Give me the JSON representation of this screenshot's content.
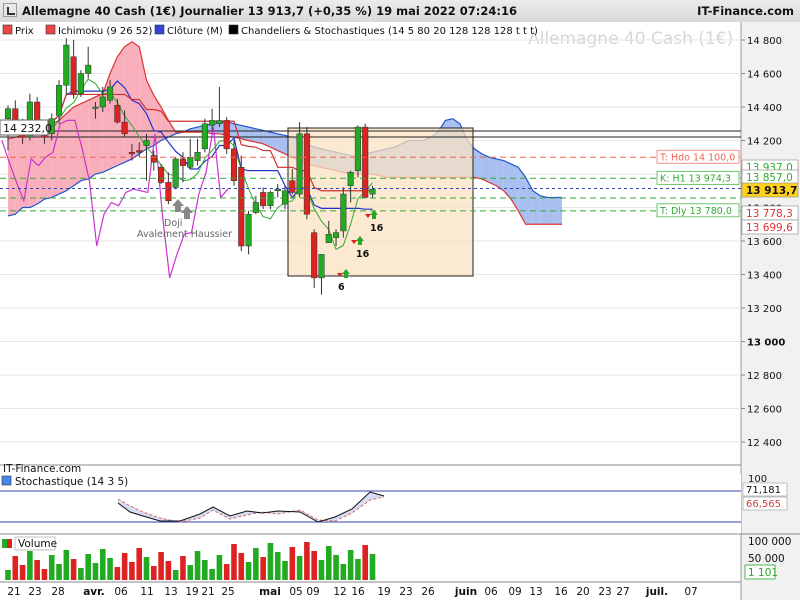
{
  "header": {
    "title": "Allemagne 40 Cash (1€) Journalier 13 913,7 (+0,35 %) 19 mai 2022 07:24:16",
    "brand": "IT-Finance.com",
    "watermark": "Allemagne 40 Cash (1€)"
  },
  "legend": [
    {
      "label": "Prix",
      "color": "#ee4444"
    },
    {
      "label": "Ichimoku (9 26 52)",
      "color": "#ee4444"
    },
    {
      "label": "Clôture (M)",
      "color": "#3344dd"
    },
    {
      "label": "Chandeliers & Stochastiques (14 5 80 20 128 128 128 t t t)",
      "color": "#000000"
    }
  ],
  "price_axis": {
    "ticks": [
      "14 800",
      "14 600",
      "14 400",
      "14 200",
      "14 000",
      "13 800",
      "13 600",
      "13 400",
      "13 200",
      "13 000",
      "12 800",
      "12 600",
      "12 400"
    ],
    "last_price": "13 913,7",
    "level_labels": [
      "13 778,3",
      "13 699,6",
      "13 937,0",
      "13 857,0"
    ]
  },
  "level_lines": [
    {
      "label": "T: Hdo 14 100,0",
      "value": 14100
    },
    {
      "label": "K: H1 13 974,3",
      "value": 13974.3
    },
    {
      "label": "T: Dly 13 780,0",
      "value": 13780
    }
  ],
  "left_label": "14 232,0",
  "pattern_label": {
    "line1": "Doji",
    "line2": "Avalement Haussier"
  },
  "signal_labels": [
    "16",
    "16",
    "6"
  ],
  "x_axis": {
    "labels": [
      "21",
      "23",
      "28",
      "avr.",
      "06",
      "11",
      "13",
      "19",
      "21",
      "25",
      "mai",
      "05",
      "09",
      "12",
      "16",
      "19",
      "23",
      "26",
      "juin",
      "06",
      "09",
      "13",
      "16",
      "20",
      "23",
      "27",
      "juil.",
      "07"
    ]
  },
  "subcharts": {
    "copyright": "IT-Finance.com",
    "stochastic": {
      "title": "Stochastique (14 3 5)",
      "top_tick": "100",
      "k_value": "71,181",
      "d_value": "66,565"
    },
    "volume": {
      "title": "Volume",
      "ticks": [
        "100 000",
        "50 000"
      ],
      "last_value": "1 101"
    }
  },
  "colors": {
    "up": "#22aa22",
    "down": "#dd2222",
    "cloud_bear": "#f7a6b4",
    "cloud_bull": "#9fb8ee",
    "box_fill": "#fbe1c2"
  },
  "chart_data": {
    "type": "candlestick",
    "title": "Allemagne 40 Cash (1€) Journalier",
    "ylim": [
      12300,
      14900
    ],
    "candles": [
      {
        "o": 14330,
        "h": 14410,
        "l": 14140,
        "c": 14390
      },
      {
        "o": 14390,
        "h": 14440,
        "l": 14240,
        "c": 14270
      },
      {
        "o": 14270,
        "h": 14330,
        "l": 14180,
        "c": 14220
      },
      {
        "o": 14220,
        "h": 14480,
        "l": 14200,
        "c": 14430
      },
      {
        "o": 14430,
        "h": 14460,
        "l": 14280,
        "c": 14320
      },
      {
        "o": 14230,
        "h": 14290,
        "l": 14180,
        "c": 14220
      },
      {
        "o": 14240,
        "h": 14360,
        "l": 14200,
        "c": 14330
      },
      {
        "o": 14350,
        "h": 14560,
        "l": 14300,
        "c": 14530
      },
      {
        "o": 14530,
        "h": 14810,
        "l": 14470,
        "c": 14770
      },
      {
        "o": 14700,
        "h": 14800,
        "l": 14450,
        "c": 14480
      },
      {
        "o": 14480,
        "h": 14620,
        "l": 14460,
        "c": 14600
      },
      {
        "o": 14600,
        "h": 14760,
        "l": 14570,
        "c": 14650
      },
      {
        "o": 14400,
        "h": 14430,
        "l": 14330,
        "c": 14400
      },
      {
        "o": 14400,
        "h": 14520,
        "l": 14370,
        "c": 14460
      },
      {
        "o": 14440,
        "h": 14560,
        "l": 14420,
        "c": 14520
      },
      {
        "o": 14410,
        "h": 14450,
        "l": 14300,
        "c": 14310
      },
      {
        "o": 14310,
        "h": 14380,
        "l": 14220,
        "c": 14240
      },
      {
        "o": 14130,
        "h": 14180,
        "l": 14080,
        "c": 14120
      },
      {
        "o": 14140,
        "h": 14190,
        "l": 14100,
        "c": 14130
      },
      {
        "o": 14170,
        "h": 14240,
        "l": 13960,
        "c": 14200
      },
      {
        "o": 14110,
        "h": 14140,
        "l": 14020,
        "c": 14070
      },
      {
        "o": 14040,
        "h": 14060,
        "l": 13940,
        "c": 13950
      },
      {
        "o": 13950,
        "h": 14010,
        "l": 13820,
        "c": 13840
      },
      {
        "o": 13920,
        "h": 14100,
        "l": 13910,
        "c": 14090
      },
      {
        "o": 14090,
        "h": 14130,
        "l": 13950,
        "c": 14050
      },
      {
        "o": 14040,
        "h": 14210,
        "l": 14030,
        "c": 14100
      },
      {
        "o": 14080,
        "h": 14210,
        "l": 14050,
        "c": 14130
      },
      {
        "o": 14150,
        "h": 14330,
        "l": 14130,
        "c": 14300
      },
      {
        "o": 14290,
        "h": 14390,
        "l": 14260,
        "c": 14320
      },
      {
        "o": 14300,
        "h": 14520,
        "l": 14280,
        "c": 14320
      },
      {
        "o": 14320,
        "h": 14340,
        "l": 14120,
        "c": 14150
      },
      {
        "o": 14150,
        "h": 14200,
        "l": 13930,
        "c": 13960
      },
      {
        "o": 14040,
        "h": 14110,
        "l": 13540,
        "c": 13570
      },
      {
        "o": 13570,
        "h": 13780,
        "l": 13520,
        "c": 13760
      },
      {
        "o": 13770,
        "h": 13870,
        "l": 13760,
        "c": 13830
      },
      {
        "o": 13890,
        "h": 13920,
        "l": 13790,
        "c": 13810
      },
      {
        "o": 13810,
        "h": 13900,
        "l": 13790,
        "c": 13890
      },
      {
        "o": 13900,
        "h": 13940,
        "l": 13860,
        "c": 13910
      },
      {
        "o": 13820,
        "h": 13930,
        "l": 13790,
        "c": 13900
      },
      {
        "o": 13960,
        "h": 14030,
        "l": 13880,
        "c": 13890
      },
      {
        "o": 13880,
        "h": 14310,
        "l": 13860,
        "c": 14240
      },
      {
        "o": 14240,
        "h": 14280,
        "l": 13730,
        "c": 13760
      },
      {
        "o": 13650,
        "h": 13670,
        "l": 13320,
        "c": 13380
      },
      {
        "o": 13380,
        "h": 13520,
        "l": 13280,
        "c": 13520
      },
      {
        "o": 13590,
        "h": 13720,
        "l": 13590,
        "c": 13640
      },
      {
        "o": 13620,
        "h": 13670,
        "l": 13570,
        "c": 13650
      },
      {
        "o": 13660,
        "h": 13920,
        "l": 13620,
        "c": 13880
      },
      {
        "o": 13930,
        "h": 14020,
        "l": 13830,
        "c": 14010
      },
      {
        "o": 14020,
        "h": 14290,
        "l": 13980,
        "c": 14280
      },
      {
        "o": 14280,
        "h": 14300,
        "l": 13880,
        "c": 13860
      },
      {
        "o": 13880,
        "h": 13930,
        "l": 13860,
        "c": 13910
      }
    ],
    "ichimoku_senkou_a": [
      13750,
      13760,
      13800,
      13800,
      13820,
      13850,
      13860,
      13880,
      13900,
      13930,
      13960,
      13970,
      14000,
      14010,
      14030,
      14050,
      14070,
      14090,
      14120,
      14150,
      14170,
      14200,
      14220,
      14240,
      14250,
      14270,
      14280,
      14290,
      14300,
      14310,
      14310,
      14300,
      14290,
      14280,
      14270,
      14260,
      14250,
      14240,
      14230,
      14220,
      14200,
      14180,
      14160,
      14150,
      14140,
      14130,
      14120,
      14110,
      14100,
      14120,
      14130,
      14140,
      14150,
      14160,
      14180,
      14200,
      14200,
      14200,
      14220,
      14250,
      14320,
      14330,
      14300,
      14200,
      14150,
      14120,
      14100,
      14090,
      14080,
      14060,
      14040,
      13980,
      13900,
      13870,
      13860,
      13860,
      13860
    ],
    "ichimoku_senkou_b": [
      14210,
      14220,
      14230,
      14240,
      14260,
      14280,
      14300,
      14320,
      14360,
      14400,
      14420,
      14440,
      14460,
      14480,
      14600,
      14700,
      14760,
      14790,
      14760,
      14560,
      14470,
      14400,
      14320,
      14250,
      14250,
      14250,
      14250,
      14250,
      14240,
      14240,
      14230,
      14220,
      14210,
      14200,
      14190,
      14180,
      14160,
      14140,
      14120,
      14100,
      14080,
      14060,
      14050,
      14040,
      14030,
      14020,
      14010,
      14000,
      14000,
      14000,
      14000,
      13990,
      13980,
      13980,
      13980,
      13980,
      13980,
      13980,
      13980,
      13980,
      13980,
      13980,
      13980,
      13980,
      13980,
      13970,
      13950,
      13930,
      13900,
      13850,
      13780,
      13700,
      13700,
      13700,
      13700,
      13700,
      13700
    ]
  }
}
